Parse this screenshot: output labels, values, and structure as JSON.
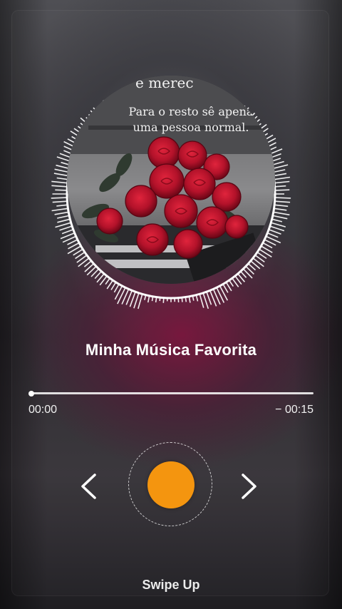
{
  "cover": {
    "top_caption": "e merec",
    "caption": "Para o resto sê apena\numa pessoa normal.",
    "image": "red-roses-on-piano"
  },
  "player": {
    "title": "Minha Música Favorita",
    "elapsed": "00:00",
    "remaining": "− 00:15",
    "progress": 0.005,
    "accent_color": "#f4950f"
  },
  "controls": {
    "prev_icon": "chevron-left-icon",
    "next_icon": "chevron-right-icon",
    "play_icon": "play-button"
  },
  "footer": {
    "swipe_label": "Swipe Up"
  }
}
